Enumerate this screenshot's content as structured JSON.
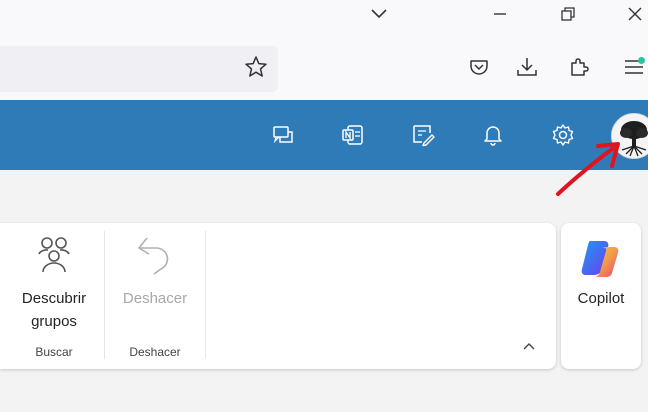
{
  "window_controls": {
    "tabs_menu_icon": "chevron-down-icon",
    "minimize_icon": "minimize-icon",
    "restore_icon": "restore-icon",
    "close_icon": "close-icon"
  },
  "browser_toolbar": {
    "bookmark_icon": "star-icon",
    "tools": [
      "pocket-icon",
      "download-icon",
      "extensions-icon",
      "menu-icon"
    ],
    "notification_dot_color": "#2ac3a2"
  },
  "app_header": {
    "color": "#2e7bb8",
    "icons": [
      "feedback-icon",
      "onenote-icon",
      "whiteboard-icon",
      "bell-icon",
      "gear-icon"
    ],
    "avatar": "tree-avatar"
  },
  "ribbon": {
    "descubrir": {
      "label_line1": "Descubrir",
      "label_line2": "grupos",
      "group": "Buscar"
    },
    "deshacer": {
      "label": "Deshacer",
      "group": "Deshacer",
      "disabled": true
    },
    "collapse_icon": "chevron-up-icon"
  },
  "copilot": {
    "label": "Copilot"
  },
  "annotation": {
    "color": "#e0141e"
  }
}
